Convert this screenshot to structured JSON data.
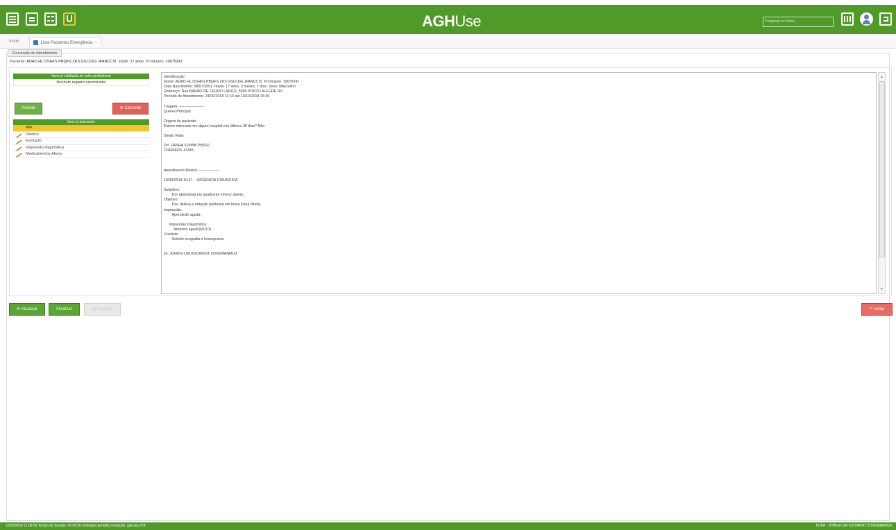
{
  "app": {
    "logo_bold": "AGH",
    "logo_light": "Use"
  },
  "header": {
    "search_placeholder": "Pesquisar no Menu"
  },
  "tabs": [
    {
      "label": "Início"
    },
    {
      "label": "Lista Pacientes Emergência"
    }
  ],
  "section": {
    "title": "Conclusão do Atendimento"
  },
  "patient": {
    "paciente_label": "Paciente:",
    "paciente_value": "ADAO HL OSHFS PBQFS ZKS GSLCKG JFANCCSI",
    "idade_label": "Idade:",
    "idade_value": "17 anos",
    "prontuario_label": "Prontuário:",
    "prontuario_value": "10675247"
  },
  "pending": {
    "header": "Itens p/ validação de outro profissional",
    "empty": "Nenhum registro encontrado!"
  },
  "actions": {
    "assinar": "Assinar",
    "cancelar": "Cancelar"
  },
  "items_list": {
    "header": "Itens já assinados",
    "items": [
      {
        "label": "Alta"
      },
      {
        "label": "Destino"
      },
      {
        "label": "Evolução"
      },
      {
        "label": "Impressão diagnóstica"
      },
      {
        "label": "Medicamentos Ativos"
      }
    ]
  },
  "document": {
    "lines": [
      "Identificação",
      "Nome: ADAO HL OSHFS PBQFS ZKS GSLCKG JFANCCSI  Prontuário: 10675247",
      "Data Nascimento: 08/07/2001  Idade: 17 anos, 3 meses, 7 dias  Sexo: Masculino",
      "Endereço: Rua BARÃO DE CERRO LARGO, 5900 PORTO ALEGRE RS",
      "Período de Atendimento: 24/09/2018 11:10 até 10/10/2018 15:36",
      "",
      "Triagem ---------------------",
      "Queixa Principal:",
      "",
      "Origem do paciente:",
      "Esteve internado em algum hospital nos últimos 30 dias? Não",
      "",
      "Sinais Vitais",
      "",
      "Drª. FANHA XJPWB PBZHJ",
      "CREMERS 12345",
      "",
      "",
      "",
      "Atendimento Médico -----------------",
      "",
      "10/09/2018 10:47 -  URGENCIA CIRURGICA",
      "",
      "Subjetivo:",
      "        Dor abdominal em quadrante inferior direito.",
      "Objetivo:",
      "        Dor, defesa e irritação peritonial em fossa ilíaca direita.",
      "Impressão:",
      "        Apendicite aguda.",
      "",
      "     Impressão Diagnóstica:",
      "          Abdome agudo(R10.0)",
      "Conduta:",
      "        Solicito ecografia e hemograma",
      "",
      "",
      "Dr. JOHN ETJM KXOWKNT ZOXEWANMU3"
    ]
  },
  "bottom_buttons": {
    "atualizar": "Atualizar",
    "finalizar": "Finalizar",
    "imprimir": "Imprimir",
    "voltar": "Voltar"
  },
  "status": {
    "left": "10/10/2018 11:09:58  Tempo de Sessão: 01:00:00  emergenciamedico  Estação: aghuse-378",
    "right": "HCPA · JOHN ETJM KXOWKNT ZOXEWANMU3"
  },
  "colors": {
    "brand_green": "#4f9a28",
    "highlight": "#f5c52a",
    "danger": "#e0605a"
  }
}
